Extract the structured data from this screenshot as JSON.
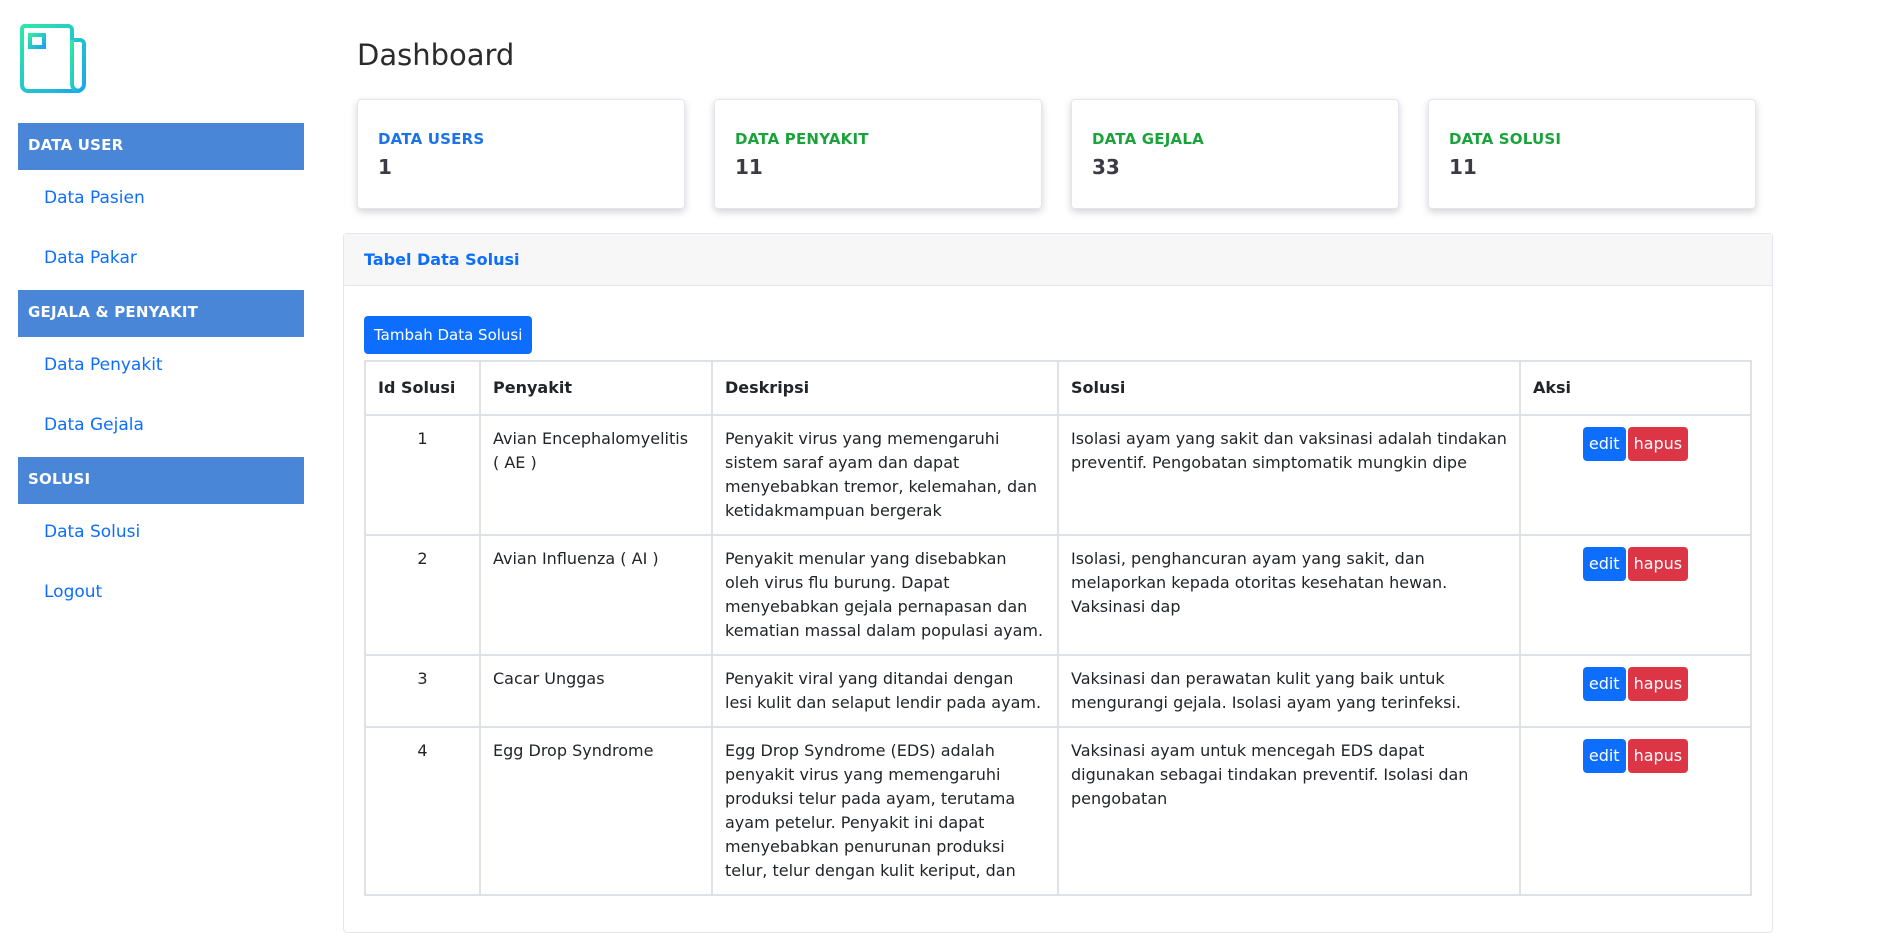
{
  "sidebar": {
    "sections": [
      {
        "heading": "DATA USER",
        "links": [
          "Data Pasien",
          "Data Pakar"
        ]
      },
      {
        "heading": "GEJALA & PENYAKIT",
        "links": [
          "Data Penyakit",
          "Data Gejala"
        ]
      },
      {
        "heading": "SOLUSI",
        "links": [
          "Data Solusi",
          "Logout"
        ]
      }
    ]
  },
  "page_title": "Dashboard",
  "stats": [
    {
      "label": "DATA USERS",
      "value": "1",
      "color": "#1a73e8"
    },
    {
      "label": "DATA PENYAKIT",
      "value": "11",
      "color": "#1aa33b"
    },
    {
      "label": "DATA GEJALA",
      "value": "33",
      "color": "#1aa33b"
    },
    {
      "label": "DATA SOLUSI",
      "value": "11",
      "color": "#1aa33b"
    }
  ],
  "panel": {
    "title": "Tabel Data Solusi",
    "add_button": "Tambah Data Solusi",
    "columns": [
      "Id Solusi",
      "Penyakit",
      "Deskripsi",
      "Solusi",
      "Aksi"
    ],
    "rows": [
      {
        "id": "1",
        "penyakit": "Avian Encephalomyelitis ( AE )",
        "deskripsi": "Penyakit virus yang memengaruhi sistem saraf ayam dan dapat menyebabkan tremor, kelemahan, dan ketidakmampuan bergerak",
        "solusi": "Isolasi ayam yang sakit dan vaksinasi adalah tindakan preventif. Pengobatan simptomatik mungkin dipe",
        "edit": "edit",
        "hapus": "hapus"
      },
      {
        "id": "2",
        "penyakit": "Avian Influenza ( AI )",
        "deskripsi": "Penyakit menular yang disebabkan oleh virus flu burung. Dapat menyebabkan gejala pernapasan dan kematian massal dalam populasi ayam.",
        "solusi": "Isolasi, penghancuran ayam yang sakit, dan melaporkan kepada otoritas kesehatan hewan. Vaksinasi dap",
        "edit": "edit",
        "hapus": "hapus"
      },
      {
        "id": "3",
        "penyakit": "Cacar Unggas",
        "deskripsi": "Penyakit viral yang ditandai dengan lesi kulit dan selaput lendir pada ayam.",
        "solusi": "Vaksinasi dan perawatan kulit yang baik untuk mengurangi gejala. Isolasi ayam yang terinfeksi.",
        "edit": "edit",
        "hapus": "hapus"
      },
      {
        "id": "4",
        "penyakit": "Egg Drop Syndrome",
        "deskripsi": "Egg Drop Syndrome (EDS) adalah penyakit virus yang memengaruhi produksi telur pada ayam, terutama ayam petelur. Penyakit ini dapat menyebabkan penurunan produksi telur, telur dengan kulit keriput, dan",
        "solusi": "Vaksinasi ayam untuk mencegah EDS dapat digunakan sebagai tindakan preventif. Isolasi dan pengobatan",
        "edit": "edit",
        "hapus": "hapus"
      }
    ]
  }
}
